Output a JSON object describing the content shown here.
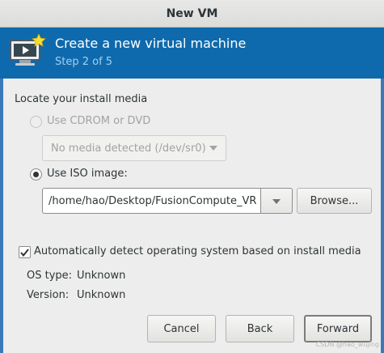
{
  "window": {
    "title": "New VM"
  },
  "banner": {
    "title": "Create a new virtual machine",
    "step": "Step 2 of 5"
  },
  "media": {
    "section_label": "Locate your install media",
    "cdrom_option": "Use CDROM or DVD",
    "cdrom_combo": "No media detected (/dev/sr0)",
    "iso_option": "Use ISO image:",
    "iso_path": "/home/hao/Desktop/FusionCompute_VR",
    "browse_label": "Browse..."
  },
  "detect": {
    "auto_detect_label": "Automatically detect operating system based on install media",
    "os_type_label": "OS type:",
    "os_type_value": "Unknown",
    "version_label": "Version:",
    "version_value": "Unknown"
  },
  "footer": {
    "cancel_label": "Cancel",
    "back_label": "Back",
    "forward_label": "Forward"
  },
  "watermark": "CSDN @hao_wujing",
  "colors": {
    "banner": "#0f6aad",
    "step_text": "#9fd0ef",
    "window_bg": "#ededed"
  },
  "icons": [
    "vm-monitor-icon",
    "star-icon",
    "chevron-down-icon",
    "checkmark-icon"
  ],
  "state": {
    "selected_source": "iso",
    "cdrom_enabled": false,
    "auto_detect_checked": true
  }
}
